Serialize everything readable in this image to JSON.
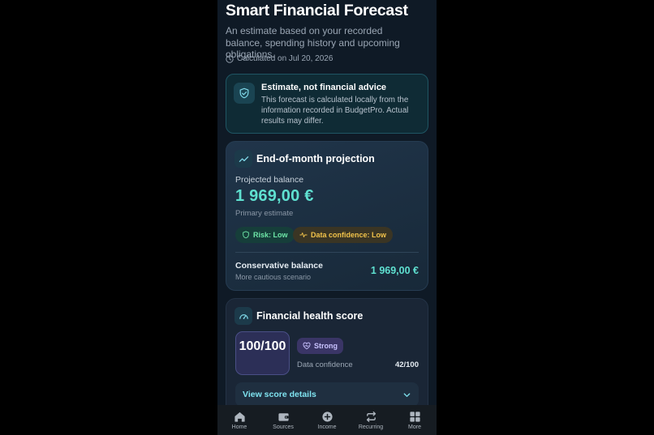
{
  "header": {
    "title": "Smart Financial Forecast",
    "subtitle": "An estimate based on your recorded balance, spending history and upcoming obligations.",
    "calculated": "Calculated on Jul 20, 2026"
  },
  "notice": {
    "title": "Estimate, not financial advice",
    "text": "This forecast is calculated locally from the information recorded in BudgetPro. Actual results may differ.",
    "icon": "shield-check-icon"
  },
  "projection": {
    "title": "End-of-month projection",
    "icon": "trend-line-icon",
    "projected_label": "Projected balance",
    "projected_value": "1 969,00 €",
    "projected_sub": "Primary estimate",
    "risk": "Risk: Low",
    "confidence": "Data confidence: Low",
    "conservative_label": "Conservative balance",
    "conservative_sub": "More cautious scenario",
    "conservative_value": "1 969,00 €"
  },
  "health": {
    "title": "Financial health score",
    "icon": "gauge-icon",
    "score": "100/100",
    "status": "Strong",
    "data_confidence_label": "Data confidence",
    "data_confidence_value": "42/100",
    "details_label": "View score details"
  },
  "nav": {
    "items": [
      {
        "label": "Home",
        "icon": "home-icon"
      },
      {
        "label": "Sources",
        "icon": "wallet-icon"
      },
      {
        "label": "Income",
        "icon": "plus-circle-icon"
      },
      {
        "label": "Recurring",
        "icon": "repeat-icon"
      },
      {
        "label": "More",
        "icon": "grid-icon"
      }
    ]
  },
  "colors": {
    "background": "#0f1a26",
    "accent_teal": "#5fe0d0",
    "risk_green": "#6ee7a8",
    "warning_yellow": "#f1c24a",
    "score_purple": "#2c2f57"
  }
}
